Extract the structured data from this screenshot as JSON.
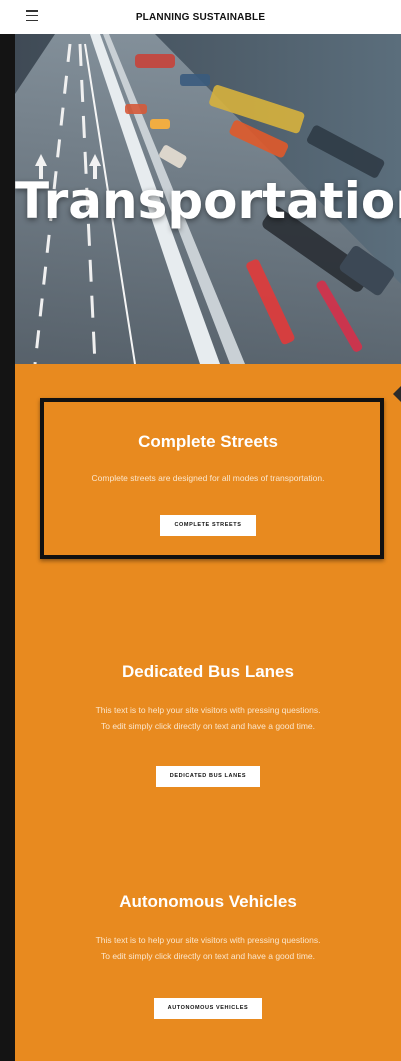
{
  "header": {
    "title": "PLANNING SUSTAINABLE",
    "menu_icon": "hamburger-icon"
  },
  "hero": {
    "title": "Transportation"
  },
  "sections": [
    {
      "heading": "Complete Streets",
      "text_lines": [
        "Complete streets are designed for all modes of transportation."
      ],
      "button_label": "COMPLETE STREETS"
    },
    {
      "heading": "Dedicated Bus Lanes",
      "text_lines": [
        "This text is to help your site visitors with pressing questions.",
        "To edit simply click directly on text and have a good time."
      ],
      "button_label": "DEDICATED BUS LANES"
    },
    {
      "heading": "Autonomous Vehicles",
      "text_lines": [
        "This text is to help your site visitors with pressing questions.",
        "To edit simply click directly on text and have a good time."
      ],
      "button_label": "AUTONOMOUS VEHICLES"
    }
  ],
  "colors": {
    "accent": "#e88a1f",
    "header_bg": "#ffffff",
    "frame": "#111111"
  }
}
